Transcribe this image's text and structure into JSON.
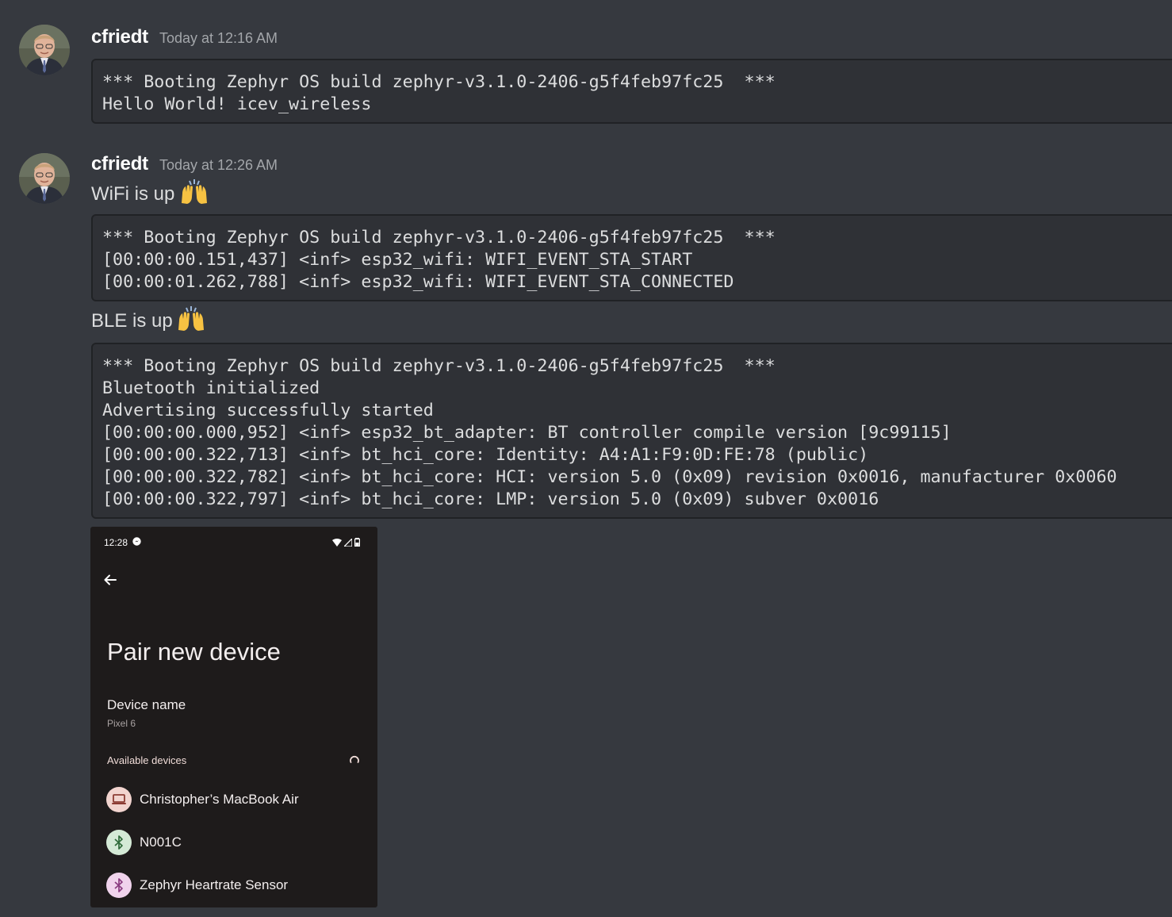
{
  "messages": [
    {
      "username": "cfriedt",
      "timestamp": "Today at 12:16 AM",
      "code": [
        "*** Booting Zephyr OS build zephyr-v3.1.0-2406-g5f4feb97fc25  ***",
        "Hello World! icev_wireless"
      ]
    },
    {
      "username": "cfriedt",
      "timestamp": "Today at 12:26 AM",
      "text1": "WiFi is up",
      "code1": [
        "*** Booting Zephyr OS build zephyr-v3.1.0-2406-g5f4feb97fc25  ***",
        "[00:00:00.151,437] <inf> esp32_wifi: WIFI_EVENT_STA_START",
        "[00:00:01.262,788] <inf> esp32_wifi: WIFI_EVENT_STA_CONNECTED"
      ],
      "text2": "BLE is up",
      "code2": [
        "*** Booting Zephyr OS build zephyr-v3.1.0-2406-g5f4feb97fc25  ***",
        "Bluetooth initialized",
        "Advertising successfully started",
        "[00:00:00.000,952] <inf> esp32_bt_adapter: BT controller compile version [9c99115]",
        "[00:00:00.322,713] <inf> bt_hci_core: Identity: A4:A1:F9:0D:FE:78 (public)",
        "[00:00:00.322,782] <inf> bt_hci_core: HCI: version 5.0 (0x09) revision 0x0016, manufacturer 0x0060",
        "[00:00:00.322,797] <inf> bt_hci_core: LMP: version 5.0 (0x09) subver 0x0016"
      ]
    }
  ],
  "emoji": "raising-hands",
  "phone": {
    "status_time": "12:28",
    "title": "Pair new device",
    "device_name_label": "Device name",
    "device_name_value": "Pixel 6",
    "available_label": "Available devices",
    "devices": [
      {
        "name": "Christopher’s MacBook Air",
        "icon": "laptop-icon",
        "icon_bg": "#f2d4cf",
        "icon_color": "#8c3b33"
      },
      {
        "name": "N001C",
        "icon": "bluetooth-icon",
        "icon_bg": "#d4ead6",
        "icon_color": "#2f6b3a"
      },
      {
        "name": "Zephyr Heartrate Sensor",
        "icon": "bluetooth-icon",
        "icon_bg": "#f0d3ec",
        "icon_color": "#8a3c80"
      }
    ]
  },
  "colors": {
    "background": "#36393f",
    "codeblock_bg": "#2f3136",
    "username": "#ffffff",
    "timestamp": "#a3a6aa",
    "phone_bg": "#1e1b1b"
  }
}
